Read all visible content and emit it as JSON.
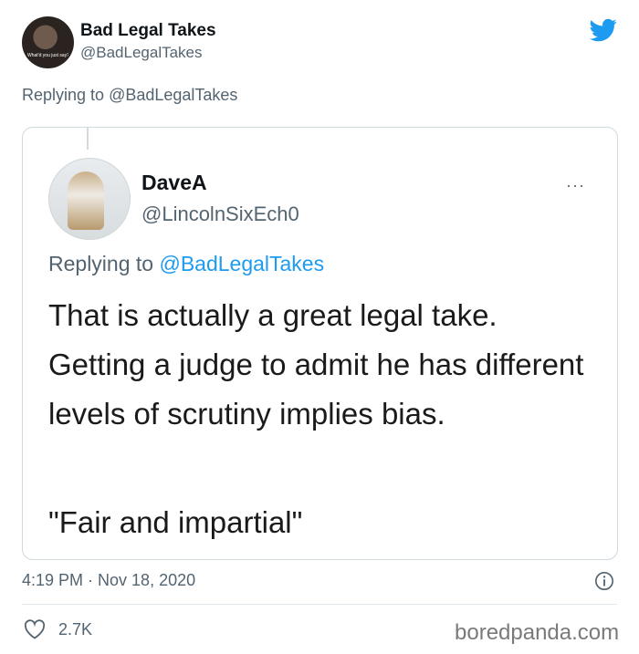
{
  "author": {
    "name": "Bad Legal Takes",
    "handle": "@BadLegalTakes",
    "avatar_caption": "What'd you just say?"
  },
  "reply_context": {
    "prefix": "Replying to ",
    "mention": "@BadLegalTakes"
  },
  "quoted_tweet": {
    "name": "DaveA",
    "handle": "@LincolnSixEch0",
    "reply_prefix": "Replying to ",
    "reply_mention": "@BadLegalTakes",
    "body": "That is actually a great legal take. Getting a judge to admit he has different levels of scrutiny implies bias.",
    "quote": "\"Fair and impartial\"",
    "more_label": "···"
  },
  "footer": {
    "timestamp": "4:19 PM · Nov 18, 2020",
    "likes": "2.7K",
    "watermark": "boredpanda.com"
  },
  "colors": {
    "twitter_blue": "#1d9bf0",
    "secondary_text": "#536471",
    "border": "#cfd9de"
  },
  "icons": [
    "twitter-bird-icon",
    "more-icon",
    "info-icon",
    "heart-icon"
  ]
}
